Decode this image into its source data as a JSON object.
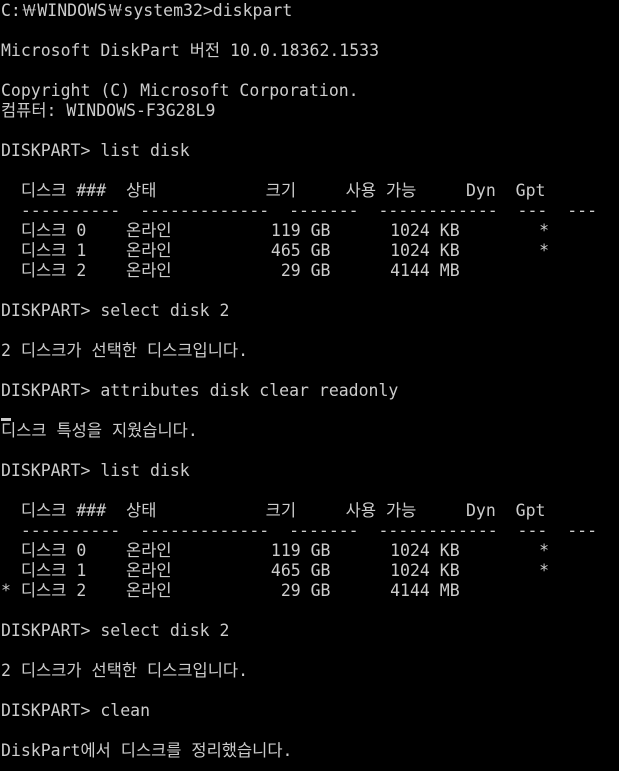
{
  "console": {
    "lines": [
      "C:￦WINDOWS￦system32>diskpart",
      "",
      "Microsoft DiskPart 버전 10.0.18362.1533",
      "",
      "Copyright (C) Microsoft Corporation.",
      "컴퓨터: WINDOWS-F3G28L9",
      "",
      "DISKPART> list disk",
      "",
      "  디스크 ###  상태           크기     사용 가능     Dyn  Gpt",
      "  ----------  -------------  -------  ------------  ---  ---",
      "  디스크 0    온라인          119 GB      1024 KB        *",
      "  디스크 1    온라인          465 GB      1024 KB        *",
      "  디스크 2    온라인           29 GB      4144 MB",
      "",
      "DISKPART> select disk 2",
      "",
      "2 디스크가 선택한 디스크입니다.",
      "",
      "DISKPART> attributes disk clear readonly",
      "",
      "디스크 특성을 지웠습니다.",
      "",
      "DISKPART> list disk",
      "",
      "  디스크 ###  상태           크기     사용 가능     Dyn  Gpt",
      "  ----------  -------------  -------  ------------  ---  ---",
      "  디스크 0    온라인          119 GB      1024 KB        *",
      "  디스크 1    온라인          465 GB      1024 KB        *",
      "* 디스크 2    온라인           29 GB      4144 MB",
      "",
      "DISKPART> select disk 2",
      "",
      "2 디스크가 선택한 디스크입니다.",
      "",
      "DISKPART> clean",
      "",
      "DiskPart에서 디스크를 정리했습니다."
    ]
  }
}
